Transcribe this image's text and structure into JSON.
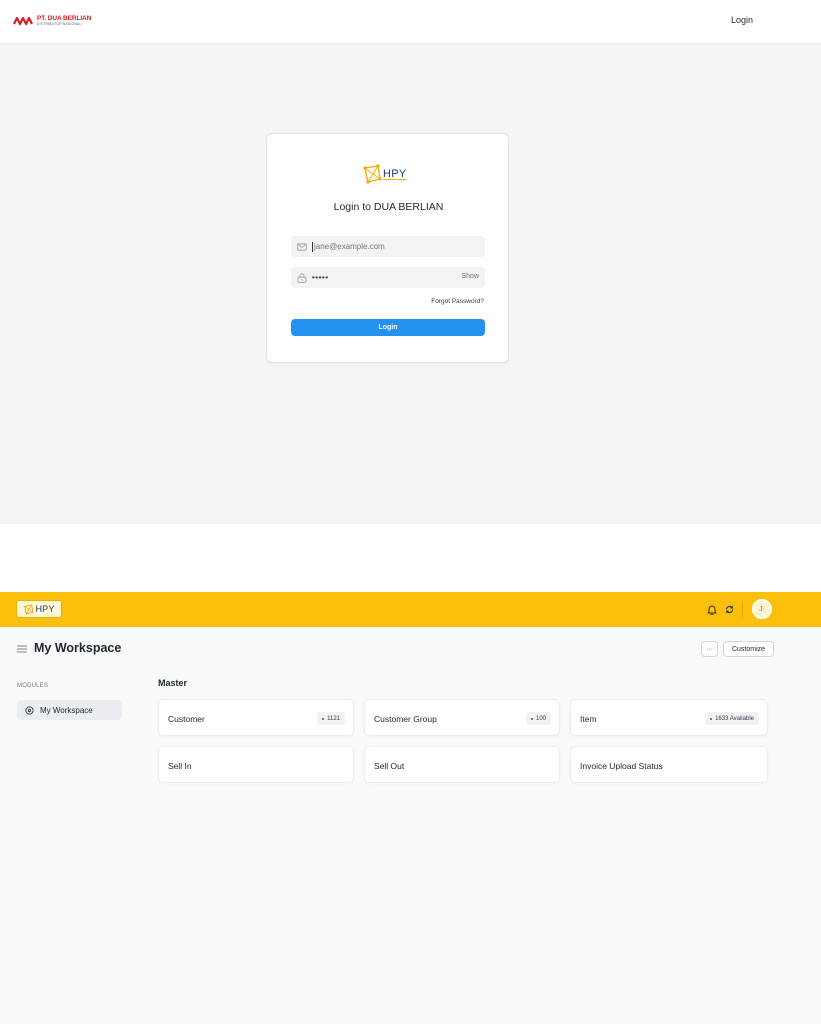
{
  "login": {
    "brand_name": "PT. DUA BERLIAN",
    "brand_sub": "DISTRIBUTOR NASIONAL",
    "nav_login_label": "Login",
    "logo_text": "HPY",
    "title": "Login to DUA BERLIAN",
    "email_placeholder": "jane@example.com",
    "password_value": "•••••",
    "show_label": "Show",
    "forgot_label": "Forgot Password?",
    "login_button_label": "Login"
  },
  "workspace": {
    "logo_text": "HPY",
    "avatar_initials": "J·",
    "page_title": "My Workspace",
    "more_label": "···",
    "customize_label": "Customize",
    "sidebar_heading": "MODULES",
    "sidebar_items": [
      {
        "label": "My Workspace"
      }
    ],
    "section_title": "Master",
    "tiles": [
      {
        "label": "Customer",
        "badge": "1121"
      },
      {
        "label": "Customer Group",
        "badge": "100"
      },
      {
        "label": "Item",
        "badge": "1633 Available"
      },
      {
        "label": "Sell In",
        "badge": ""
      },
      {
        "label": "Sell Out",
        "badge": ""
      },
      {
        "label": "Invoice Upload Status",
        "badge": ""
      }
    ]
  },
  "colors": {
    "navbar_yellow": "#fbc00b",
    "primary_blue": "#2490ef",
    "brand_red": "#d32027"
  },
  "icons": [
    "brand-logo-icon",
    "hpy-logo-icon",
    "mail-icon",
    "lock-icon",
    "bell-icon",
    "sync-icon",
    "menu-icon",
    "workspace-icon"
  ]
}
